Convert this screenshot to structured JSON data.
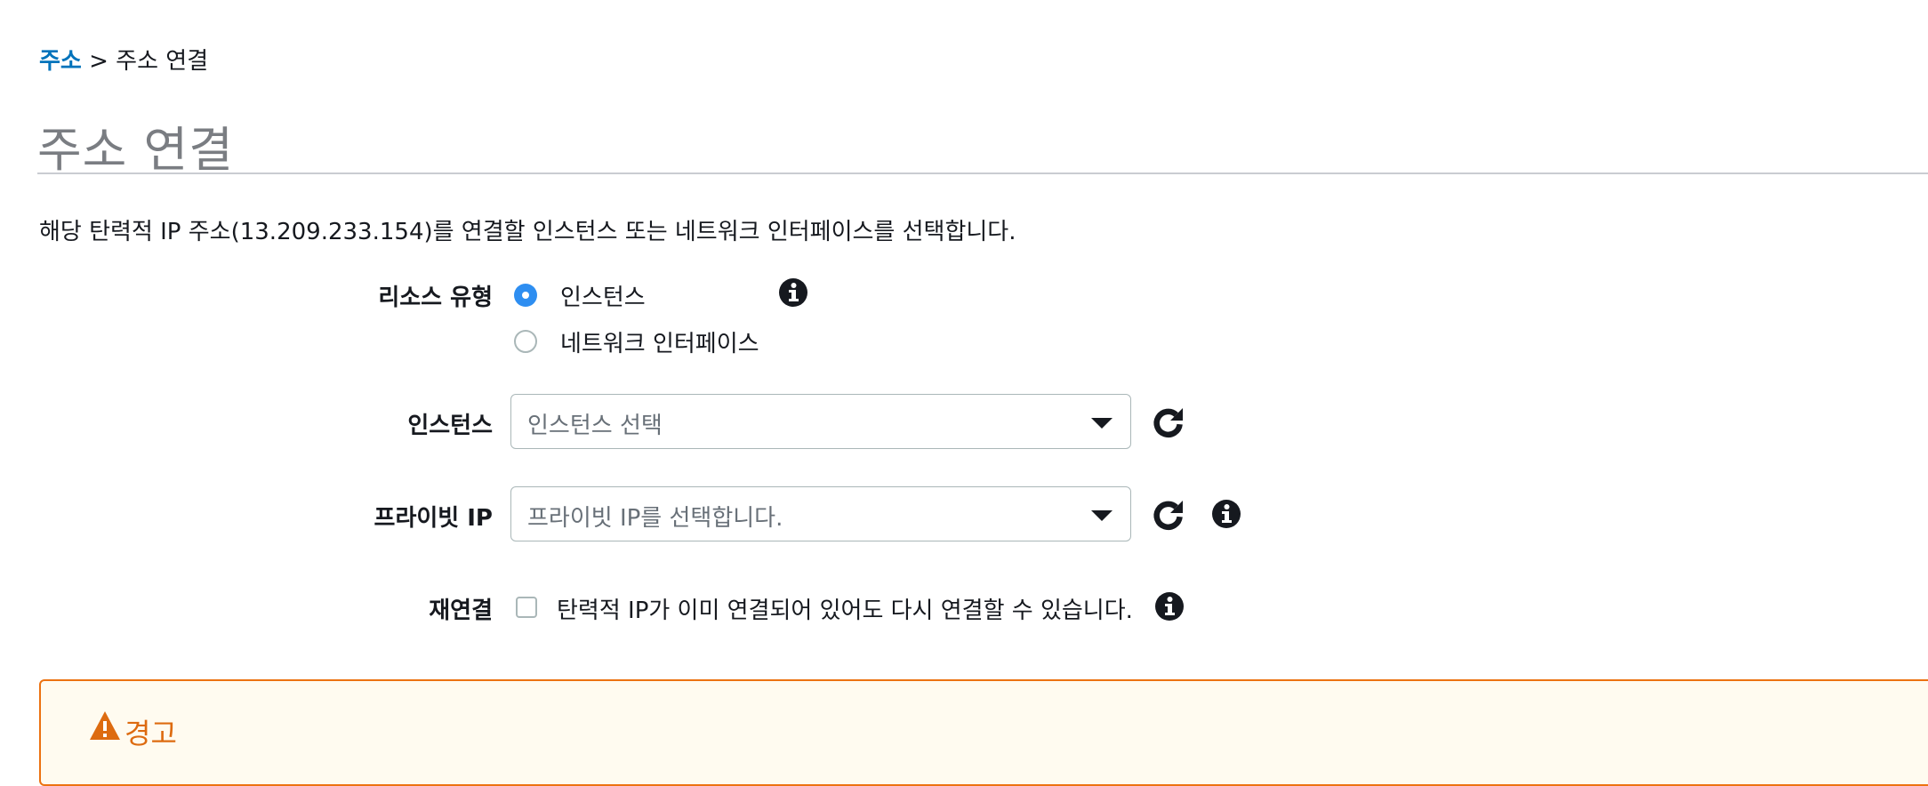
{
  "breadcrumb": {
    "link": "주소",
    "separator": " > ",
    "current": "주소 연결"
  },
  "page_title": "주소 연결",
  "description": "해당 탄력적 IP 주소(13.209.233.154)를 연결할 인스턴스 또는 네트워크 인터페이스를 선택합니다.",
  "resource_type": {
    "label": "리소스 유형",
    "options": [
      {
        "label": "인스턴스",
        "selected": true
      },
      {
        "label": "네트워크 인터페이스",
        "selected": false
      }
    ]
  },
  "instance": {
    "label": "인스턴스",
    "placeholder": "인스턴스 선택"
  },
  "private_ip": {
    "label": "프라이빗 IP",
    "placeholder": "프라이빗 IP를 선택합니다."
  },
  "reassociation": {
    "label": "재연결",
    "checkbox_label": "탄력적 IP가 이미 연결되어 있어도 다시 연결할 수 있습니다.",
    "checked": false
  },
  "warning": {
    "title": "경고"
  },
  "colors": {
    "link": "#0073bb",
    "radio_selected": "#2e8ef1",
    "warning_border": "#ec7211",
    "warning_text": "#dd6b10"
  }
}
